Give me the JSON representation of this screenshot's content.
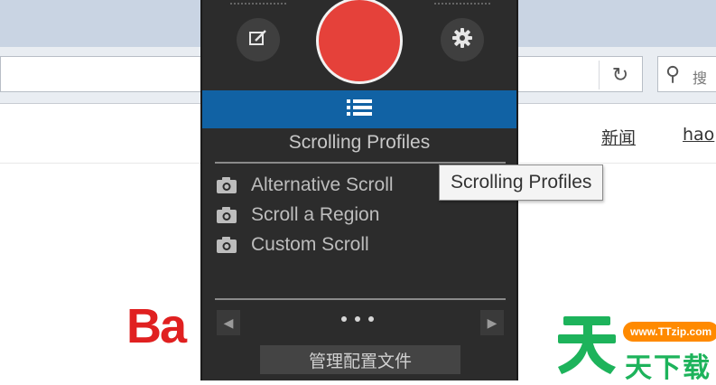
{
  "browser": {
    "search_placeholder": "搜",
    "nav_links": [
      "新闻",
      "hao"
    ],
    "logo_text": "Ba"
  },
  "widget": {
    "section_title": "Scrolling Profiles",
    "profiles": [
      {
        "label": "Alternative Scroll",
        "icon": "camera-icon"
      },
      {
        "label": "Scroll a Region",
        "icon": "camera-icon"
      },
      {
        "label": "Custom Scroll",
        "icon": "camera-icon"
      }
    ],
    "manage_button_label": "管理配置文件",
    "tooltip": "Scrolling Profiles",
    "icons": {
      "left": "edit-capture-icon",
      "right": "gear-icon",
      "bar": "list-icon"
    },
    "colors": {
      "record": "#e5413a",
      "profiles_bar": "#1162a4",
      "panel": "#2c2c2c"
    }
  },
  "watermark": {
    "url": "www.TTzip.com",
    "text": "天下载"
  }
}
